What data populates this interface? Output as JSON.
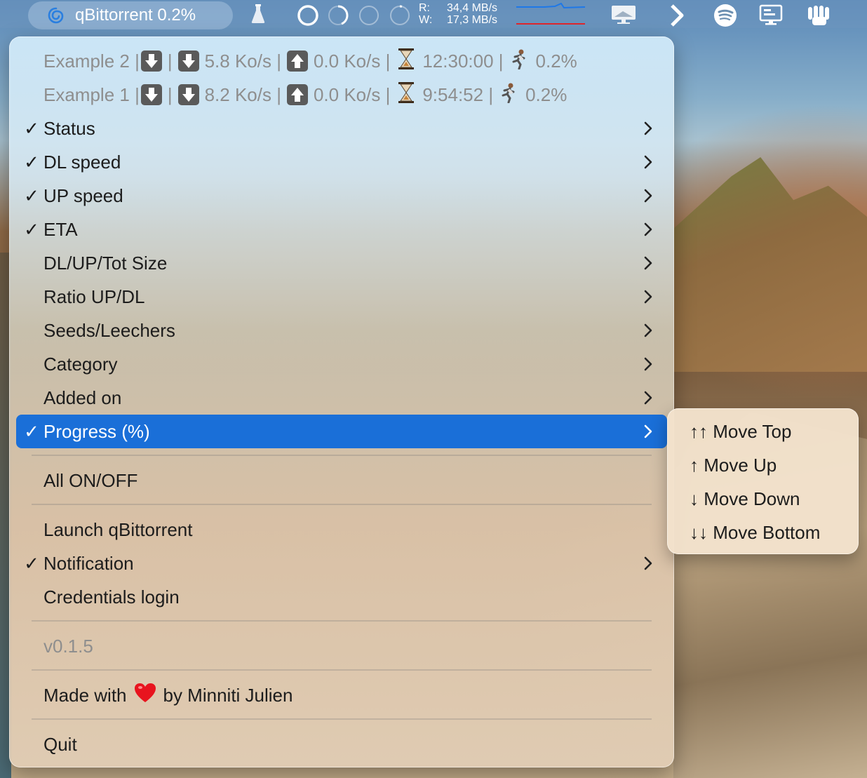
{
  "menubar": {
    "app_title": "qBittorrent 0.2%",
    "disk_read_label": "R:",
    "disk_read_value": "34,4 MB/s",
    "disk_write_label": "W:",
    "disk_write_value": "17,3 MB/s",
    "icons": [
      "qbittorrent-logo-icon",
      "flask-icon",
      "ring-full-icon",
      "ring-partial-icon",
      "ring-empty-icon",
      "ring-tick-icon",
      "display-icon",
      "chevron-right-icon",
      "spotify-icon",
      "monitor-icon",
      "fingers-icon"
    ]
  },
  "menu": {
    "torrents": [
      {
        "name": "Example 2 |",
        "sep1": "|",
        "dl_speed": "5.8 Ko/s |",
        "up_speed": "0.0 Ko/s |",
        "eta": "12:30:00 |",
        "progress": "0.2%"
      },
      {
        "name": "Example 1 |",
        "sep1": "|",
        "dl_speed": "8.2 Ko/s |",
        "up_speed": "0.0 Ko/s |",
        "eta": "9:54:52 |",
        "progress": "0.2%"
      }
    ],
    "items": [
      {
        "label": "Status",
        "checked": true,
        "submenu": true
      },
      {
        "label": "DL speed",
        "checked": true,
        "submenu": true
      },
      {
        "label": "UP speed",
        "checked": true,
        "submenu": true
      },
      {
        "label": "ETA",
        "checked": true,
        "submenu": true
      },
      {
        "label": "DL/UP/Tot Size",
        "checked": false,
        "submenu": true
      },
      {
        "label": "Ratio UP/DL",
        "checked": false,
        "submenu": true
      },
      {
        "label": "Seeds/Leechers",
        "checked": false,
        "submenu": true
      },
      {
        "label": "Category",
        "checked": false,
        "submenu": true
      },
      {
        "label": "Added on",
        "checked": false,
        "submenu": true
      },
      {
        "label": "Progress (%)",
        "checked": true,
        "submenu": true,
        "selected": true
      }
    ],
    "check_mark": "✓",
    "all_on_off": "All ON/OFF",
    "launch": "Launch qBittorrent",
    "notification": "Notification",
    "credentials": "Credentials login",
    "version": "v0.1.5",
    "made_with_prefix": "Made with",
    "made_with_suffix": "by Minniti Julien",
    "quit": "Quit"
  },
  "submenu": {
    "items": [
      "↑↑ Move Top",
      "↑ Move Up",
      "↓ Move Down",
      "↓↓ Move Bottom"
    ]
  },
  "colors": {
    "selection": "#1a6fd8",
    "disk_read_line": "#1e78e8",
    "disk_write_line": "#e0262c"
  }
}
